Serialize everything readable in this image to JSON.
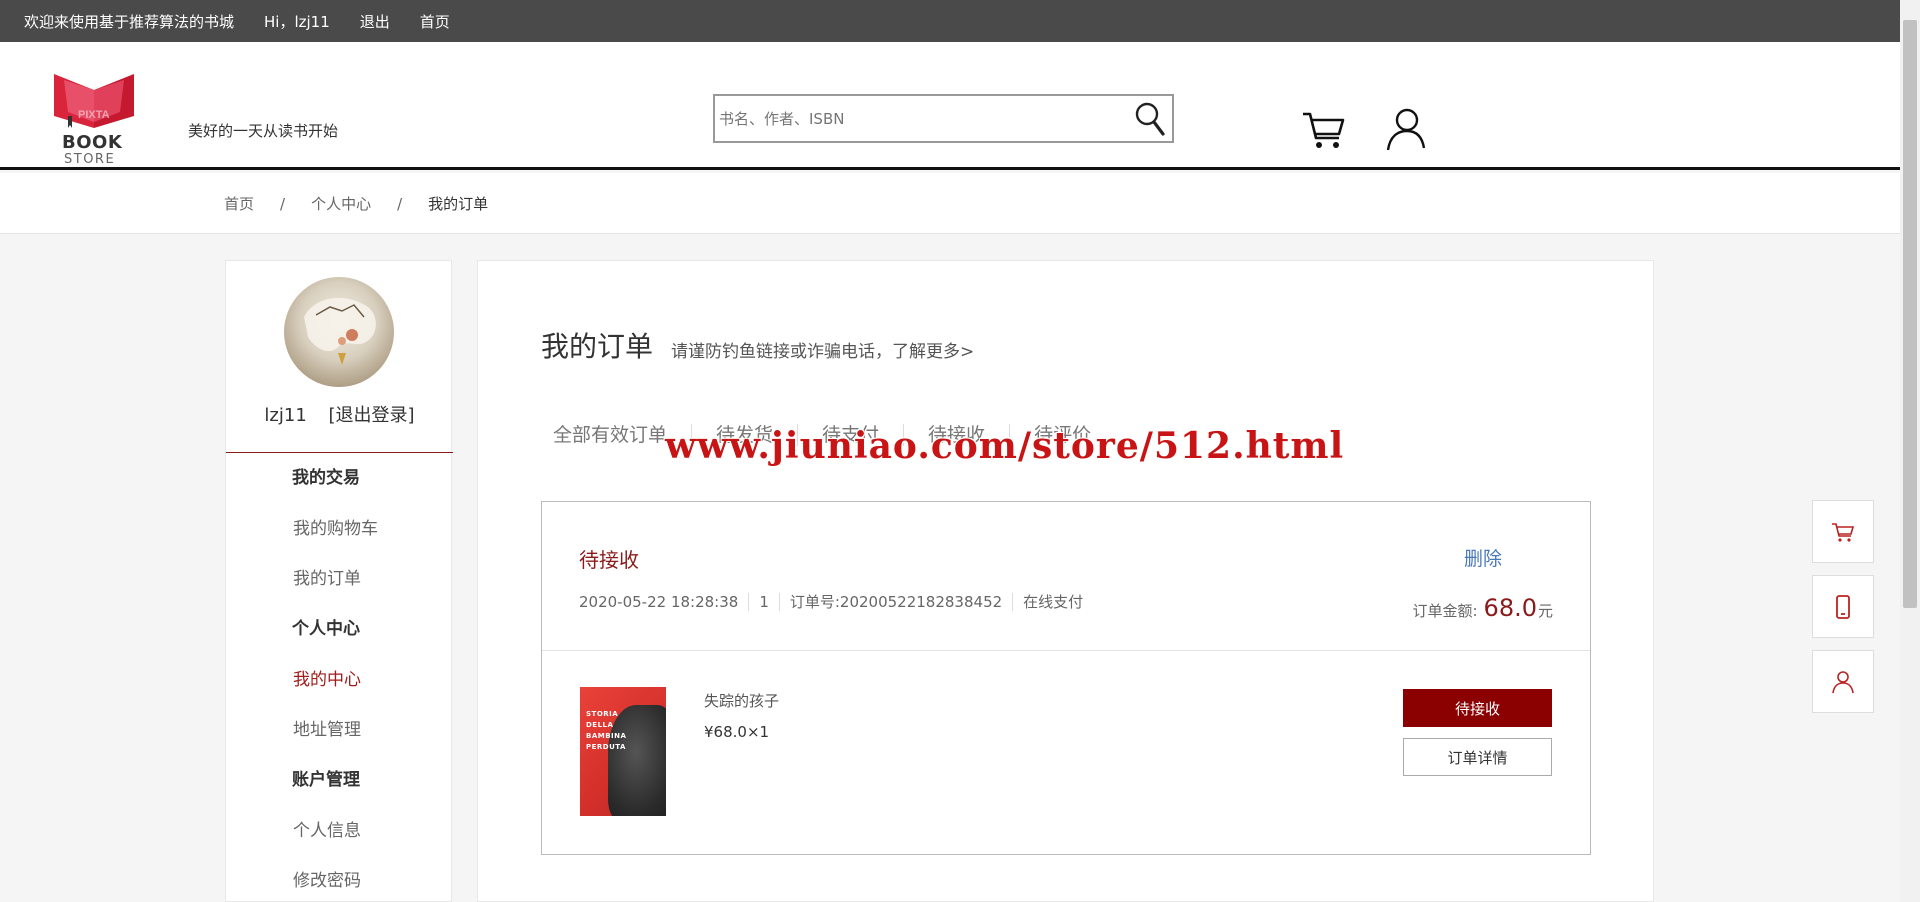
{
  "topbar": {
    "welcome": "欢迎来使用基于推荐算法的书城",
    "greeting": "Hi，lzj11",
    "logout": "退出",
    "home": "首页"
  },
  "header": {
    "logo_line1": "BOOK",
    "logo_line2": "STORE",
    "logo_watermark": "PIXTA",
    "slogan": "美好的一天从读书开始",
    "search_placeholder": "书名、作者、ISBN",
    "icons": {
      "search": "search-icon",
      "cart": "cart-icon",
      "user": "user-icon"
    }
  },
  "breadcrumb": {
    "items": [
      "首页",
      "个人中心",
      "我的订单"
    ],
    "separator": "/"
  },
  "sidebar": {
    "username": "lzj11",
    "logout": "[退出登录]",
    "nav": [
      {
        "type": "group",
        "label": "我的交易"
      },
      {
        "type": "item",
        "label": "我的购物车"
      },
      {
        "type": "item",
        "label": "我的订单"
      },
      {
        "type": "group",
        "label": "个人中心"
      },
      {
        "type": "item",
        "label": "我的中心",
        "active": true
      },
      {
        "type": "item",
        "label": "地址管理"
      },
      {
        "type": "group",
        "label": "账户管理"
      },
      {
        "type": "item",
        "label": "个人信息"
      },
      {
        "type": "item",
        "label": "修改密码"
      }
    ]
  },
  "main": {
    "title": "我的订单",
    "tip": "请谨防钓鱼链接或诈骗电话，了解更多>",
    "tabs": [
      "全部有效订单",
      "待发货",
      "待支付",
      "待接收",
      "待评价"
    ],
    "watermark": "www.jiuniao.com/store/512.html"
  },
  "order": {
    "status": "待接收",
    "delete": "删除",
    "datetime": "2020-05-22 18:28:38",
    "quantity": "1",
    "order_no": "订单号:20200522182838452",
    "payment": "在线支付",
    "total_label": "订单金额:",
    "total_amount": "68.0",
    "total_unit": "元",
    "book_name": "失踪的孩子",
    "book_price": "¥68.0×1",
    "cover_text": "STORIA DELLA BAMBINA PERDUTA",
    "primary_action": "待接收",
    "secondary_action": "订单详情"
  },
  "floating_tools": [
    "cart-icon",
    "phone-icon",
    "user-icon"
  ],
  "colors": {
    "topbar_bg": "#4a4a4a",
    "accent_red": "#8b0000",
    "status_red": "#8b1a1a",
    "link_blue": "#4a78b8",
    "page_bg": "#f5f5f5"
  }
}
